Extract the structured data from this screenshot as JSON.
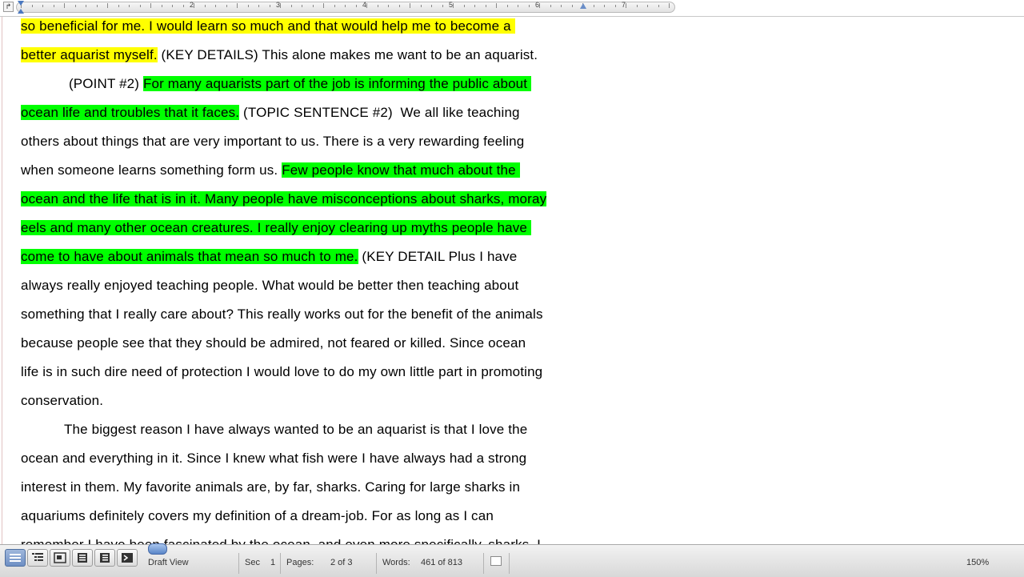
{
  "ruler": {
    "numbers": [
      "2",
      "3",
      "4",
      "5",
      "6",
      "7"
    ]
  },
  "document": {
    "lines": [
      {
        "segments": [
          {
            "text": "so beneficial for me. I would learn so much and that would help me to become a ",
            "hl": "yellow"
          }
        ]
      },
      {
        "segments": [
          {
            "text": "better aquarist myself.",
            "hl": "yellow"
          },
          {
            "text": " (KEY DETAILS) This alone makes me want to be an aquarist.",
            "hl": ""
          }
        ]
      },
      {
        "indent": 60,
        "segments": [
          {
            "text": "(POINT #2) ",
            "hl": ""
          },
          {
            "text": "For many aquarists part of the job is informing the public about ",
            "hl": "green"
          }
        ]
      },
      {
        "segments": [
          {
            "text": "ocean life and troubles that it faces.",
            "hl": "green"
          },
          {
            "text": " (TOPIC SENTENCE #2)  We all like teaching",
            "hl": ""
          }
        ]
      },
      {
        "segments": [
          {
            "text": "others about things that are very important to us. There is a very rewarding feeling",
            "hl": ""
          }
        ]
      },
      {
        "segments": [
          {
            "text": "when someone learns something form us. ",
            "hl": ""
          },
          {
            "text": "Few people know that much about the ",
            "hl": "green"
          }
        ]
      },
      {
        "segments": [
          {
            "text": "ocean and the life that is in it. Many people have misconceptions about sharks, moray",
            "hl": "green"
          }
        ]
      },
      {
        "segments": [
          {
            "text": "eels and many other ocean creatures. I really enjoy clearing up myths people have ",
            "hl": "green"
          }
        ]
      },
      {
        "segments": [
          {
            "text": "come to have about animals that mean so much to me.",
            "hl": "green"
          },
          {
            "text": " (KEY DETAIL Plus I have",
            "hl": ""
          }
        ]
      },
      {
        "segments": [
          {
            "text": "always really enjoyed teaching people. What would be better then teaching about",
            "hl": ""
          }
        ]
      },
      {
        "segments": [
          {
            "text": "something that I really care about? This really works out for the benefit of the animals",
            "hl": ""
          }
        ]
      },
      {
        "segments": [
          {
            "text": "because people see that they should be admired, not feared or killed. Since ocean",
            "hl": ""
          }
        ]
      },
      {
        "segments": [
          {
            "text": "life is in such dire need of protection I would love to do my own little part in promoting",
            "hl": ""
          }
        ]
      },
      {
        "segments": [
          {
            "text": "conservation.",
            "hl": ""
          }
        ]
      },
      {
        "indent": 54,
        "segments": [
          {
            "text": "The biggest reason I have always wanted to be an aquarist is that I love the",
            "hl": ""
          }
        ]
      },
      {
        "segments": [
          {
            "text": "ocean and everything in it. Since I knew what fish were I have always had a strong",
            "hl": ""
          }
        ]
      },
      {
        "segments": [
          {
            "text": "interest in them. My favorite animals are, by far, sharks. Caring for large sharks in",
            "hl": ""
          }
        ]
      },
      {
        "segments": [
          {
            "text": "aquariums definitely covers my definition of a dream-job. For as long as I can",
            "hl": ""
          }
        ]
      },
      {
        "segments": [
          {
            "text": "remember I have been fascinated by the ocean, and even more specifically, sharks. I",
            "hl": ""
          }
        ]
      }
    ]
  },
  "statusbar": {
    "view_name": "Draft View",
    "sec_label": "Sec",
    "sec_value": "1",
    "pages_label": "Pages:",
    "pages_value": "2 of 3",
    "words_label": "Words:",
    "words_value": "461 of 813",
    "zoom": "150%"
  },
  "colors": {
    "highlight_yellow": "#ffff00",
    "highlight_green": "#00ff00"
  }
}
